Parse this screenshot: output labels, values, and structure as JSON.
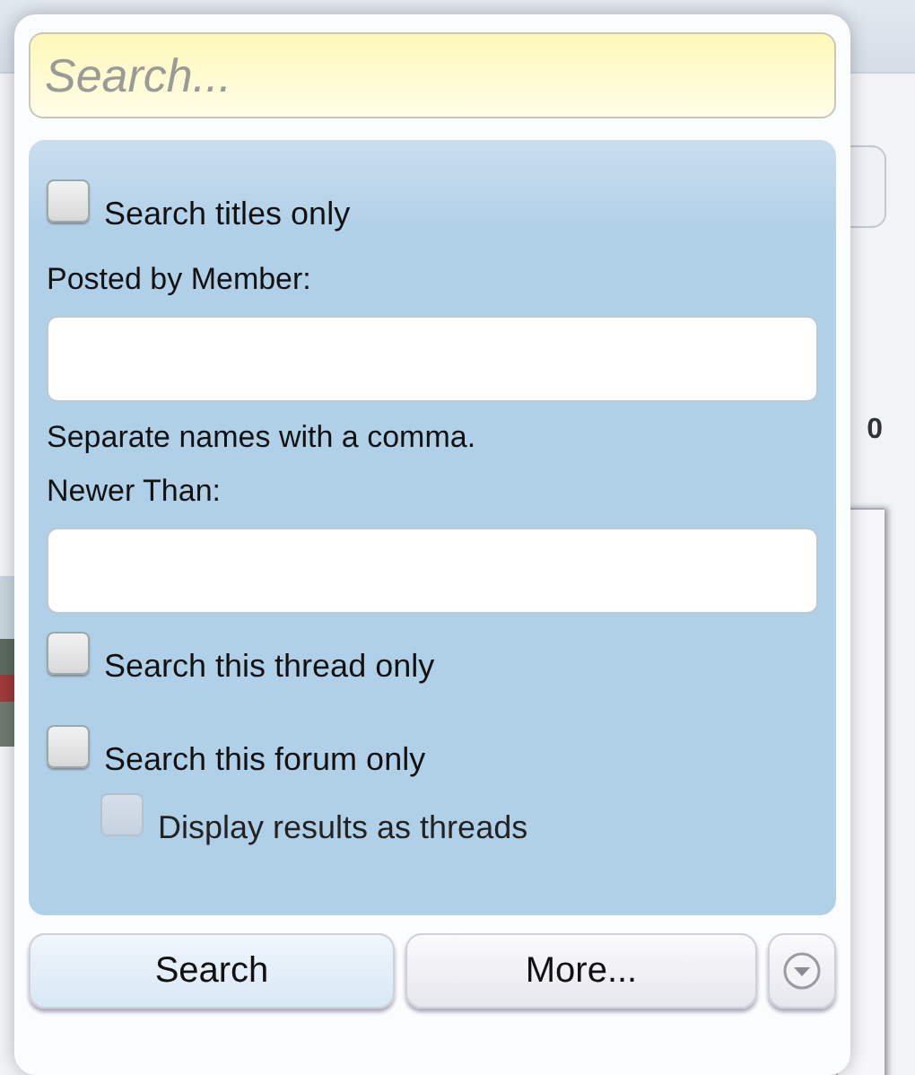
{
  "page": {
    "count": "0"
  },
  "search": {
    "placeholder": "Search..."
  },
  "options": [
    {
      "kind": "checkbox",
      "label": "Search titles only",
      "checked": false
    },
    {
      "kind": "field",
      "label": "Posted by Member:",
      "hint": "Separate names with a comma."
    },
    {
      "kind": "field",
      "label": "Newer Than:"
    },
    {
      "kind": "checkbox",
      "label": "Search this thread only",
      "checked": false
    },
    {
      "kind": "checkbox",
      "label": "Search this forum only",
      "checked": false,
      "children": [
        {
          "kind": "checkbox",
          "label": "Display results as threads",
          "checked": false,
          "disabled": true
        }
      ]
    }
  ],
  "buttons": [
    {
      "kind": "primary",
      "label": "Search"
    },
    {
      "kind": "secondary",
      "label": "More..."
    },
    {
      "kind": "menu"
    }
  ]
}
